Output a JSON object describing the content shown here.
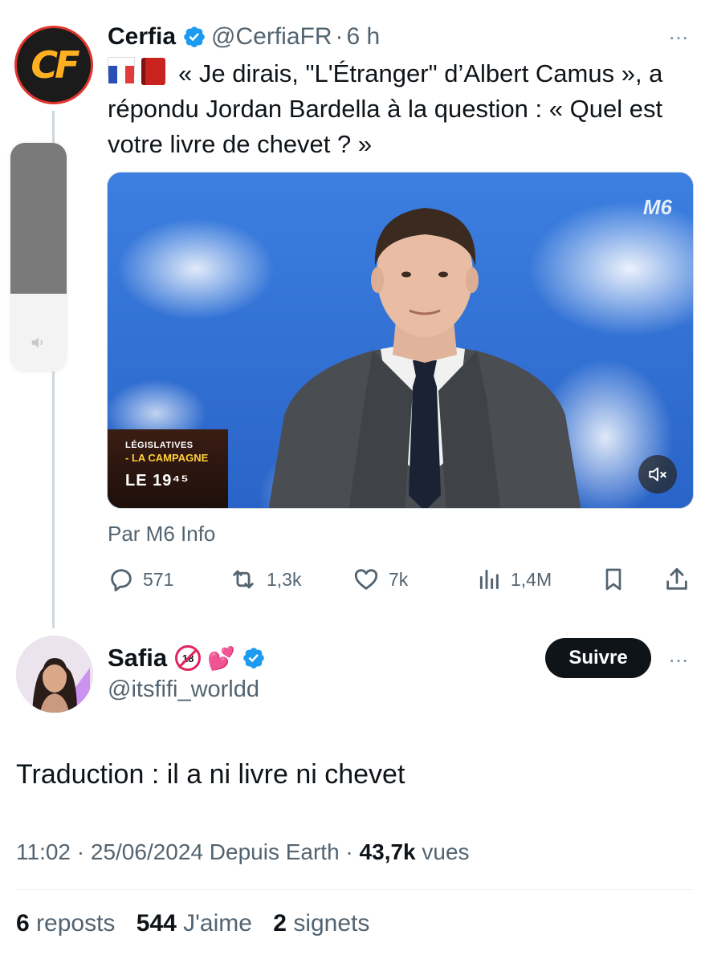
{
  "tweet1": {
    "display_name": "Cerfia",
    "handle": "@CerfiaFR",
    "separator": "·",
    "time": "6 h",
    "avatar_text": "CF",
    "text": "« Je dirais, \"L'Étranger\" d’Albert Camus », a répondu Jordan Bardella à la question : « Quel est votre livre de chevet ? »",
    "media": {
      "channel_logo": "M6",
      "banner_line1": "LÉGISLATIVES",
      "banner_line2": "- LA CAMPAGNE",
      "banner_line3": "LE 19⁴⁵"
    },
    "source": "Par M6 Info",
    "replies": "571",
    "reposts": "1,3k",
    "likes": "7k",
    "views": "1,4M"
  },
  "tweet2": {
    "display_name": "Safia",
    "badge_18": "18",
    "hearts": "💕",
    "handle": "@itsfifi_worldd",
    "follow_label": "Suivre",
    "text": "Traduction : il a ni livre ni chevet",
    "meta_time": "11:02 · 25/06/2024 Depuis Earth · ",
    "meta_views_count": "43,7k",
    "meta_views_label": " vues",
    "reposts_count": "6",
    "reposts_label": "reposts",
    "likes_count": "544",
    "likes_label": "J'aime",
    "bookmarks_count": "2",
    "bookmarks_label": "signets"
  },
  "ui": {
    "more": "···"
  },
  "colors": {
    "verified": "#1d9bf0",
    "secondary_text": "#536471",
    "primary_text": "#0f1419"
  }
}
